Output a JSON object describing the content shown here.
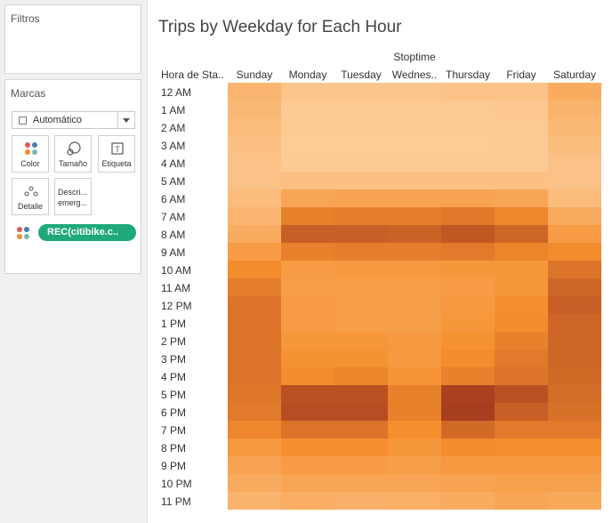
{
  "filters": {
    "title": "Filtros"
  },
  "marks": {
    "title": "Marcas",
    "mark_type": "Automático",
    "buttons": [
      {
        "label": "Color",
        "icon": "color-dots-icon"
      },
      {
        "label": "Tamaño",
        "icon": "size-icon"
      },
      {
        "label": "Etiqueta",
        "icon": "label-icon"
      },
      {
        "label": "Detalle",
        "icon": "detail-icon"
      },
      {
        "label": "Descri... emerg...",
        "icon": "tooltip-icon"
      }
    ],
    "pill": "REC(citibike.c.."
  },
  "chart_data": {
    "type": "heatmap",
    "title": "Trips by Weekday for Each Hour",
    "column_header": "Stoptime",
    "row_header": "Hora de Sta..",
    "columns": [
      "Sunday",
      "Monday",
      "Tuesday",
      "Wednes..",
      "Thursday",
      "Friday",
      "Saturday"
    ],
    "rows": [
      "12 AM",
      "1 AM",
      "2 AM",
      "3 AM",
      "4 AM",
      "5 AM",
      "6 AM",
      "7 AM",
      "8 AM",
      "9 AM",
      "10 AM",
      "11 AM",
      "12 PM",
      "1 PM",
      "2 PM",
      "3 PM",
      "4 PM",
      "5 PM",
      "6 PM",
      "7 PM",
      "8 PM",
      "9 PM",
      "10 PM",
      "11 PM"
    ],
    "values": [
      [
        0.2,
        0.08,
        0.08,
        0.08,
        0.1,
        0.1,
        0.28
      ],
      [
        0.18,
        0.05,
        0.05,
        0.05,
        0.05,
        0.06,
        0.22
      ],
      [
        0.15,
        0.04,
        0.04,
        0.04,
        0.04,
        0.05,
        0.18
      ],
      [
        0.12,
        0.03,
        0.03,
        0.03,
        0.03,
        0.04,
        0.14
      ],
      [
        0.1,
        0.04,
        0.04,
        0.04,
        0.04,
        0.04,
        0.1
      ],
      [
        0.1,
        0.12,
        0.12,
        0.12,
        0.12,
        0.12,
        0.1
      ],
      [
        0.15,
        0.32,
        0.34,
        0.34,
        0.34,
        0.32,
        0.15
      ],
      [
        0.2,
        0.58,
        0.6,
        0.6,
        0.63,
        0.55,
        0.28
      ],
      [
        0.28,
        0.78,
        0.78,
        0.76,
        0.82,
        0.74,
        0.4
      ],
      [
        0.4,
        0.58,
        0.6,
        0.6,
        0.62,
        0.56,
        0.52
      ],
      [
        0.52,
        0.4,
        0.42,
        0.42,
        0.44,
        0.44,
        0.66
      ],
      [
        0.6,
        0.38,
        0.38,
        0.38,
        0.4,
        0.44,
        0.74
      ],
      [
        0.65,
        0.4,
        0.38,
        0.38,
        0.42,
        0.5,
        0.78
      ],
      [
        0.66,
        0.4,
        0.38,
        0.38,
        0.44,
        0.52,
        0.74
      ],
      [
        0.66,
        0.44,
        0.44,
        0.42,
        0.48,
        0.58,
        0.74
      ],
      [
        0.66,
        0.48,
        0.48,
        0.42,
        0.52,
        0.62,
        0.74
      ],
      [
        0.66,
        0.52,
        0.56,
        0.46,
        0.58,
        0.66,
        0.72
      ],
      [
        0.64,
        0.86,
        0.86,
        0.58,
        0.96,
        0.86,
        0.7
      ],
      [
        0.62,
        0.88,
        0.88,
        0.58,
        0.97,
        0.78,
        0.68
      ],
      [
        0.55,
        0.66,
        0.66,
        0.5,
        0.72,
        0.62,
        0.62
      ],
      [
        0.42,
        0.5,
        0.5,
        0.44,
        0.52,
        0.5,
        0.5
      ],
      [
        0.34,
        0.4,
        0.4,
        0.38,
        0.42,
        0.42,
        0.42
      ],
      [
        0.28,
        0.33,
        0.32,
        0.32,
        0.34,
        0.36,
        0.36
      ],
      [
        0.22,
        0.26,
        0.24,
        0.25,
        0.28,
        0.32,
        0.3
      ]
    ],
    "color_scale": {
      "low": "#fdcf9d",
      "mid": "#f58f2e",
      "high": "#a3391f"
    }
  }
}
